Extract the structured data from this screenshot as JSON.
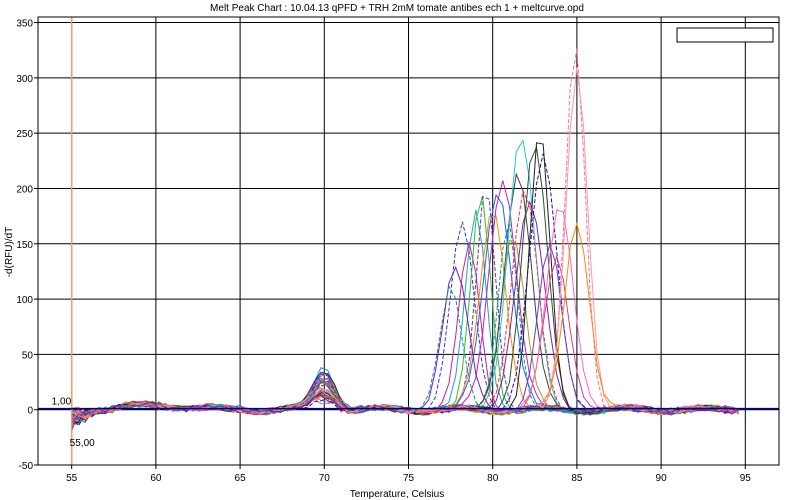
{
  "chart_data": {
    "type": "line",
    "title": "Melt Peak Chart : 10.04.13 qPFD + TRH 2mM tomate antibes ech 1 + meltcurve.opd",
    "xlabel": "Temperature, Celsius",
    "ylabel": "-d(RFU)/dT",
    "xlim": [
      53,
      97
    ],
    "ylim": [
      -50,
      355
    ],
    "xticks": [
      55,
      60,
      65,
      70,
      75,
      80,
      85,
      90,
      95
    ],
    "yticks": [
      -50,
      0,
      50,
      100,
      150,
      200,
      250,
      300,
      350
    ],
    "grid": true,
    "threshold": {
      "value": 1.0,
      "label": "1,00"
    },
    "start_marker": {
      "x": 55.0,
      "label": "55,00"
    },
    "legend": {
      "position": "top-right",
      "entries": []
    },
    "primer_dimer_peak": {
      "x": 70,
      "max_height": 52
    },
    "product_peaks": [
      {
        "x": 78.2,
        "h": 168,
        "c": "#3a2fd0"
      },
      {
        "x": 78.6,
        "h": 150,
        "c": "#d02090"
      },
      {
        "x": 79.0,
        "h": 178,
        "c": "#20a0c0"
      },
      {
        "x": 79.3,
        "h": 195,
        "c": "#30c030"
      },
      {
        "x": 79.6,
        "h": 205,
        "c": "#6030c0"
      },
      {
        "x": 80.0,
        "h": 182,
        "c": "#ff8c00"
      },
      {
        "x": 80.3,
        "h": 198,
        "c": "#2060ff"
      },
      {
        "x": 80.6,
        "h": 210,
        "c": "#c020c0"
      },
      {
        "x": 80.9,
        "h": 172,
        "c": "#00a080"
      },
      {
        "x": 81.2,
        "h": 160,
        "c": "#a0a020"
      },
      {
        "x": 81.5,
        "h": 215,
        "c": "#404040"
      },
      {
        "x": 81.7,
        "h": 248,
        "c": "#20c8e0"
      },
      {
        "x": 81.9,
        "h": 200,
        "c": "#ff3030"
      },
      {
        "x": 82.2,
        "h": 188,
        "c": "#8020a0"
      },
      {
        "x": 82.5,
        "h": 240,
        "c": "#305030"
      },
      {
        "x": 82.8,
        "h": 255,
        "c": "#202020"
      },
      {
        "x": 83.0,
        "h": 228,
        "c": "#1010a0"
      },
      {
        "x": 83.4,
        "h": 150,
        "c": "#6a3dd0"
      },
      {
        "x": 83.8,
        "h": 135,
        "c": "#d04080"
      },
      {
        "x": 84.0,
        "h": 185,
        "c": "#ff66cc"
      },
      {
        "x": 84.9,
        "h": 335,
        "c": "#ff69b4"
      },
      {
        "x": 85.0,
        "h": 312,
        "c": "#ff9999"
      },
      {
        "x": 85.0,
        "h": 172,
        "c": "#ff8800"
      },
      {
        "x": 77.8,
        "h": 128,
        "c": "#7020c0"
      },
      {
        "x": 77.5,
        "h": 110,
        "c": "#109090"
      }
    ],
    "background_series_colors": [
      "#e03030",
      "#30b030",
      "#3060e0",
      "#c0c020",
      "#c030c0",
      "#20b0b0",
      "#ff8c00",
      "#8040c0",
      "#406040",
      "#a05020",
      "#2080ff",
      "#ff60a0",
      "#00c080",
      "#606060"
    ]
  }
}
